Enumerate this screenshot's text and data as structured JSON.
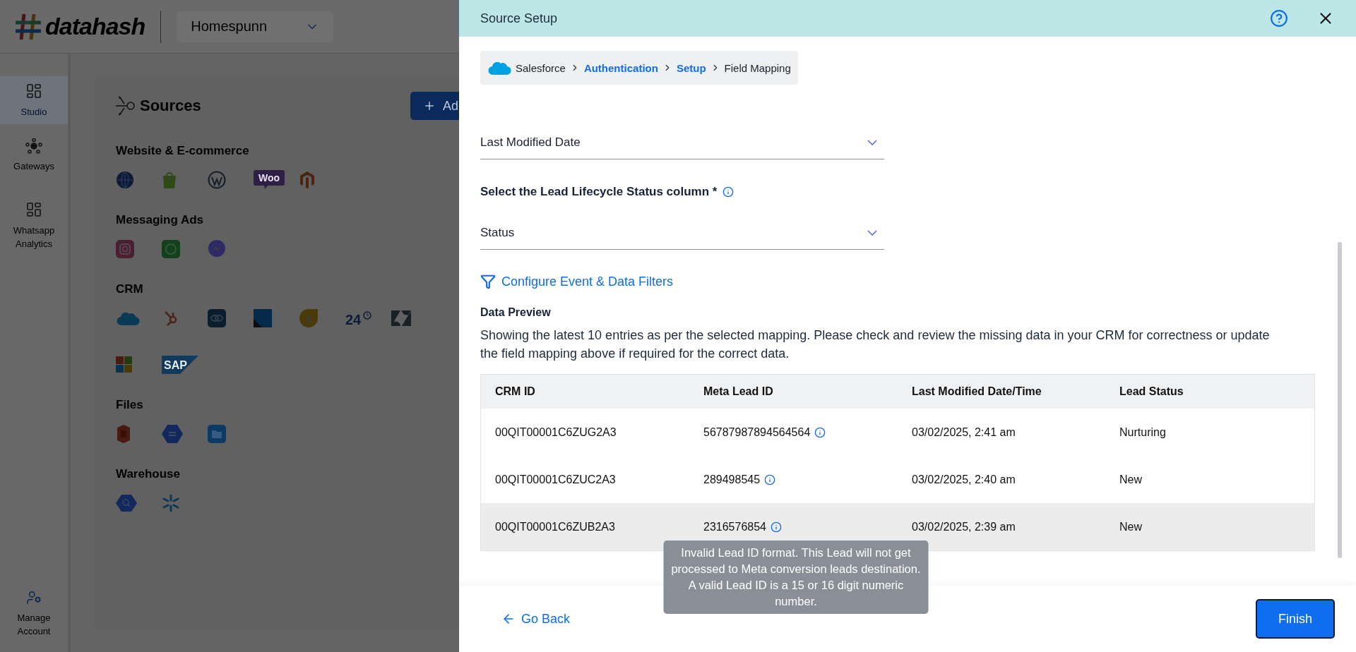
{
  "app": {
    "logo": "datahash",
    "workspace": "Homespunn",
    "nav": [
      {
        "label": "Studio",
        "selected": true
      },
      {
        "label": "Gateways",
        "selected": false
      },
      {
        "label": "Whatsapp Analytics",
        "selected": false
      }
    ],
    "account": "Manage Account",
    "page_title": "Sources",
    "add_button": "Ad",
    "sections": [
      {
        "title": "Website & E-commerce",
        "items": [
          {
            "kind": "globe"
          },
          {
            "kind": "bag"
          },
          {
            "kind": "wp"
          },
          {
            "kind": "woo",
            "label": "Woo"
          },
          {
            "kind": "hex-m"
          }
        ]
      },
      {
        "title": "Messaging Ads",
        "items": [
          {
            "kind": "camera"
          },
          {
            "kind": "chat"
          },
          {
            "kind": "bolt"
          }
        ]
      },
      {
        "title": "CRM",
        "items": [
          {
            "kind": "cloud"
          },
          {
            "kind": "hub"
          },
          {
            "kind": "rings"
          },
          {
            "kind": "square"
          },
          {
            "kind": "drop"
          },
          {
            "kind": "clock",
            "label": "24"
          },
          {
            "kind": "z"
          },
          {
            "kind": "tiles"
          },
          {
            "kind": "sap",
            "label": "SAP"
          }
        ]
      },
      {
        "title": "Files",
        "items": [
          {
            "kind": "bucket"
          },
          {
            "kind": "hexfile"
          },
          {
            "kind": "folder"
          }
        ]
      },
      {
        "title": "Warehouse",
        "items": [
          {
            "kind": "hexsearch"
          },
          {
            "kind": "flake"
          }
        ]
      }
    ]
  },
  "drawer": {
    "title": "Source Setup",
    "breadcrumb": [
      {
        "label": "Salesforce",
        "link": false
      },
      {
        "label": "Authentication",
        "link": true
      },
      {
        "label": "Setup",
        "link": true
      },
      {
        "label": "Field Mapping",
        "link": false
      }
    ],
    "mapping": [
      {
        "kind": "select",
        "text": "Last Modified Date"
      },
      {
        "kind": "label",
        "text": "Select the Lead Lifecycle Status column *"
      },
      {
        "kind": "select",
        "text": "Status"
      }
    ],
    "filter_link": "Configure Event & Data Filters",
    "preview": {
      "title": "Data Preview",
      "description": "Showing the latest 10 entries as per the selected mapping. Please check and review the missing data in your CRM for correctness or update the field mapping above if required for the correct data.",
      "columns": [
        "CRM ID",
        "Meta Lead ID",
        "Last Modified Date/Time",
        "Lead Status"
      ],
      "rows": [
        {
          "crm_id": "00QIT00001C6ZUG2A3",
          "meta_lead_id": "56787987894564564",
          "warning": true,
          "modified": "03/02/2025, 2:41 am",
          "status": "Nurturing",
          "highlighted": false
        },
        {
          "crm_id": "00QIT00001C6ZUC2A3",
          "meta_lead_id": "289498545",
          "warning": true,
          "modified": "03/02/2025, 2:40 am",
          "status": "New",
          "highlighted": false
        },
        {
          "crm_id": "00QIT00001C6ZUB2A3",
          "meta_lead_id": "2316576854",
          "warning": true,
          "modified": "03/02/2025, 2:39 am",
          "status": "New",
          "highlighted": true,
          "tooltip": "Invalid Lead ID format. This Lead will not get processed to Meta conversion leads destination. A valid Lead ID is a 15 or 16 digit numeric number."
        }
      ]
    },
    "back": "Go Back",
    "finish": "Finish"
  }
}
